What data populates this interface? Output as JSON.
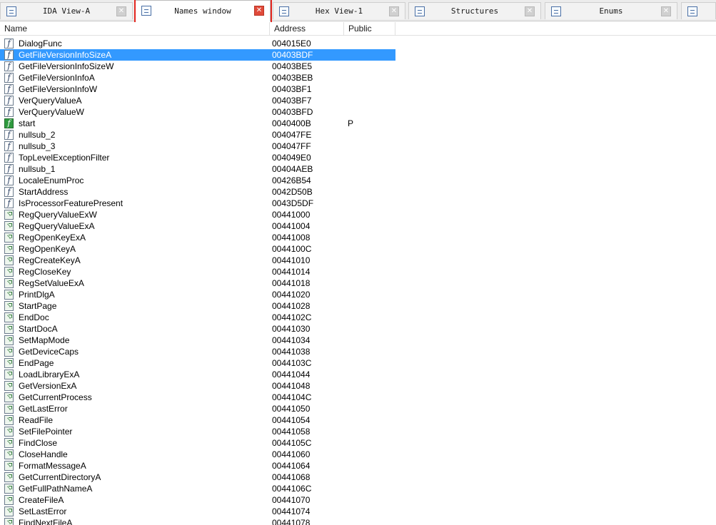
{
  "tabs": [
    {
      "label": "IDA View-A",
      "icon": "ida-view-icon",
      "active": false
    },
    {
      "label": "Names window",
      "icon": "names-window-icon",
      "active": true
    },
    {
      "label": "Hex View-1",
      "icon": "hex-view-icon",
      "active": false
    },
    {
      "label": "Structures",
      "icon": "structures-icon",
      "active": false
    },
    {
      "label": "Enums",
      "icon": "enums-icon",
      "active": false
    }
  ],
  "columns": {
    "name": "Name",
    "address": "Address",
    "public": "Public"
  },
  "colors": {
    "selection": "#3399ff",
    "highlight": "#e3261f",
    "close_active": "#e04a3a"
  },
  "rows": [
    {
      "name": "DialogFunc",
      "address": "004015E0",
      "public": "",
      "kind": "function"
    },
    {
      "name": "GetFileVersionInfoSizeA",
      "address": "00403BDF",
      "public": "",
      "kind": "function",
      "selected": true
    },
    {
      "name": "GetFileVersionInfoSizeW",
      "address": "00403BE5",
      "public": "",
      "kind": "function"
    },
    {
      "name": "GetFileVersionInfoA",
      "address": "00403BEB",
      "public": "",
      "kind": "function"
    },
    {
      "name": "GetFileVersionInfoW",
      "address": "00403BF1",
      "public": "",
      "kind": "function"
    },
    {
      "name": "VerQueryValueA",
      "address": "00403BF7",
      "public": "",
      "kind": "function"
    },
    {
      "name": "VerQueryValueW",
      "address": "00403BFD",
      "public": "",
      "kind": "function"
    },
    {
      "name": "start",
      "address": "0040400B",
      "public": "P",
      "kind": "entry"
    },
    {
      "name": "nullsub_2",
      "address": "004047FE",
      "public": "",
      "kind": "function"
    },
    {
      "name": "nullsub_3",
      "address": "004047FF",
      "public": "",
      "kind": "function"
    },
    {
      "name": "TopLevelExceptionFilter",
      "address": "004049E0",
      "public": "",
      "kind": "function"
    },
    {
      "name": "nullsub_1",
      "address": "00404AEB",
      "public": "",
      "kind": "function"
    },
    {
      "name": "LocaleEnumProc",
      "address": "00426B54",
      "public": "",
      "kind": "function"
    },
    {
      "name": "StartAddress",
      "address": "0042D50B",
      "public": "",
      "kind": "function"
    },
    {
      "name": "IsProcessorFeaturePresent",
      "address": "0043D5DF",
      "public": "",
      "kind": "function"
    },
    {
      "name": "RegQueryValueExW",
      "address": "00441000",
      "public": "",
      "kind": "import"
    },
    {
      "name": "RegQueryValueExA",
      "address": "00441004",
      "public": "",
      "kind": "import"
    },
    {
      "name": "RegOpenKeyExA",
      "address": "00441008",
      "public": "",
      "kind": "import"
    },
    {
      "name": "RegOpenKeyA",
      "address": "0044100C",
      "public": "",
      "kind": "import"
    },
    {
      "name": "RegCreateKeyA",
      "address": "00441010",
      "public": "",
      "kind": "import"
    },
    {
      "name": "RegCloseKey",
      "address": "00441014",
      "public": "",
      "kind": "import"
    },
    {
      "name": "RegSetValueExA",
      "address": "00441018",
      "public": "",
      "kind": "import"
    },
    {
      "name": "PrintDlgA",
      "address": "00441020",
      "public": "",
      "kind": "import"
    },
    {
      "name": "StartPage",
      "address": "00441028",
      "public": "",
      "kind": "import"
    },
    {
      "name": "EndDoc",
      "address": "0044102C",
      "public": "",
      "kind": "import"
    },
    {
      "name": "StartDocA",
      "address": "00441030",
      "public": "",
      "kind": "import"
    },
    {
      "name": "SetMapMode",
      "address": "00441034",
      "public": "",
      "kind": "import"
    },
    {
      "name": "GetDeviceCaps",
      "address": "00441038",
      "public": "",
      "kind": "import"
    },
    {
      "name": "EndPage",
      "address": "0044103C",
      "public": "",
      "kind": "import"
    },
    {
      "name": "LoadLibraryExA",
      "address": "00441044",
      "public": "",
      "kind": "import"
    },
    {
      "name": "GetVersionExA",
      "address": "00441048",
      "public": "",
      "kind": "import"
    },
    {
      "name": "GetCurrentProcess",
      "address": "0044104C",
      "public": "",
      "kind": "import"
    },
    {
      "name": "GetLastError",
      "address": "00441050",
      "public": "",
      "kind": "import"
    },
    {
      "name": "ReadFile",
      "address": "00441054",
      "public": "",
      "kind": "import"
    },
    {
      "name": "SetFilePointer",
      "address": "00441058",
      "public": "",
      "kind": "import"
    },
    {
      "name": "FindClose",
      "address": "0044105C",
      "public": "",
      "kind": "import"
    },
    {
      "name": "CloseHandle",
      "address": "00441060",
      "public": "",
      "kind": "import"
    },
    {
      "name": "FormatMessageA",
      "address": "00441064",
      "public": "",
      "kind": "import"
    },
    {
      "name": "GetCurrentDirectoryA",
      "address": "00441068",
      "public": "",
      "kind": "import"
    },
    {
      "name": "GetFullPathNameA",
      "address": "0044106C",
      "public": "",
      "kind": "import"
    },
    {
      "name": "CreateFileA",
      "address": "00441070",
      "public": "",
      "kind": "import"
    },
    {
      "name": "SetLastError",
      "address": "00441074",
      "public": "",
      "kind": "import"
    },
    {
      "name": "FindNextFileA",
      "address": "00441078",
      "public": "",
      "kind": "import"
    }
  ]
}
